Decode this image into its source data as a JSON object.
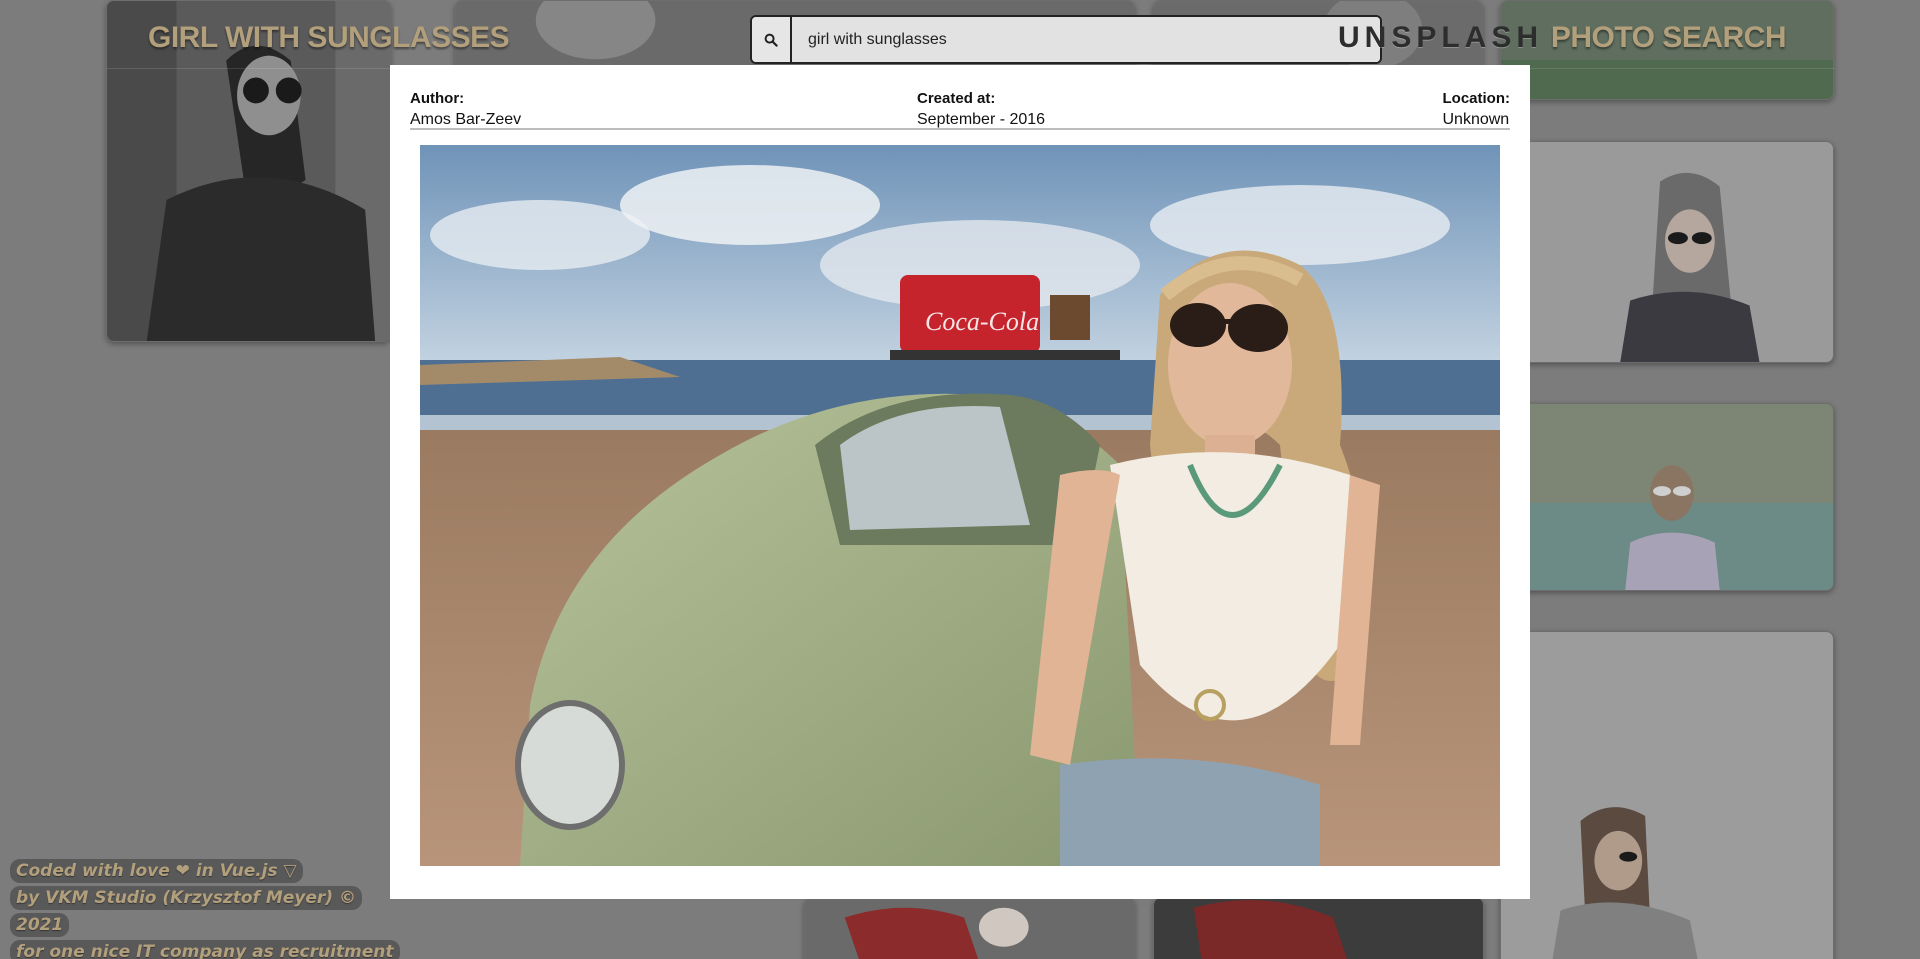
{
  "header": {
    "left_title": "GIRL WITH SUNGLASSES",
    "right_title_spaced": "UNSPLASH",
    "right_title_rest": "PHOTO SEARCH"
  },
  "search": {
    "value": "girl with sunglasses",
    "button_icon": "search-icon"
  },
  "modal": {
    "author_label": "Author:",
    "author_value": "Amos Bar-Zeev",
    "created_label": "Created at:",
    "created_value": "September - 2016",
    "location_label": "Location:",
    "location_value": "Unknown"
  },
  "footer": {
    "line1": "Coded with love ❤ in Vue.js ▽",
    "line2": "by  VKM Studio (Krzysztof Meyer)  © 2021",
    "line3": "for one nice IT company as recruitment task"
  },
  "colors": {
    "overlay_bg": "#7c7c7c",
    "title_gold": "#b29f7c",
    "modal_bg": "#ffffff"
  }
}
